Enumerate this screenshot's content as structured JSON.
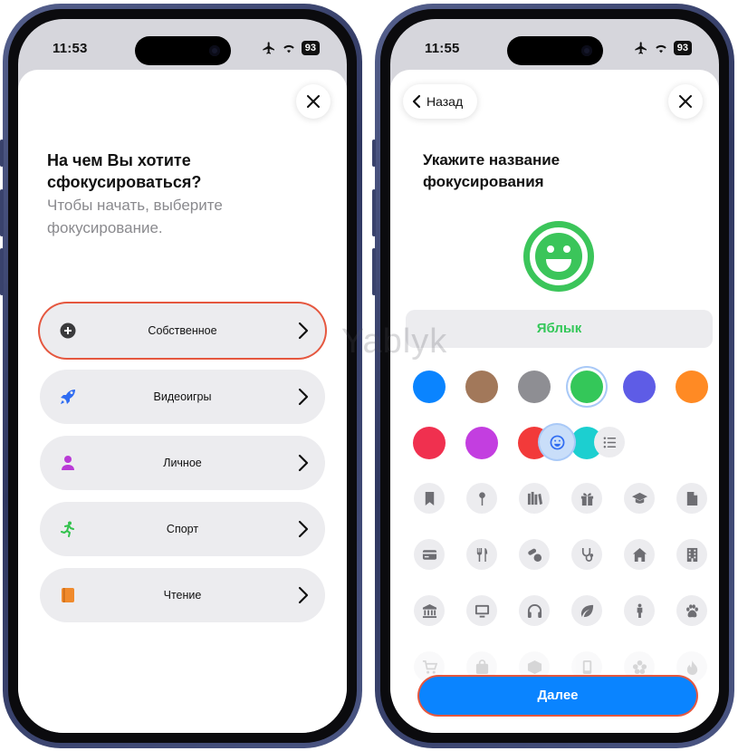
{
  "status_left": {
    "time": "11:53",
    "battery": "93"
  },
  "status_right": {
    "time": "11:55",
    "battery": "93"
  },
  "left": {
    "title": "На чем Вы хотите сфокусироваться?",
    "subtitle": "Чтобы начать, выберите фокусирование.",
    "options": [
      {
        "label": "Собственное",
        "icon": "plus-circle-icon",
        "icon_color": "#3a3a3c",
        "selected": true
      },
      {
        "label": "Видеоигры",
        "icon": "rocket-icon",
        "icon_color": "#2f6cf2",
        "selected": false
      },
      {
        "label": "Личное",
        "icon": "person-icon",
        "icon_color": "#b93bd6",
        "selected": false
      },
      {
        "label": "Спорт",
        "icon": "running-icon",
        "icon_color": "#33c24d",
        "selected": false
      },
      {
        "label": "Чтение",
        "icon": "book-icon",
        "icon_color": "#f08a2c",
        "selected": false
      }
    ]
  },
  "right": {
    "back_label": "Назад",
    "title": "Укажите название фокусирования",
    "focus_name": "Яблык",
    "accent_color": "#3bc55a",
    "colors": [
      "#0a84ff",
      "#a2785a",
      "#8e8e93",
      "#34c759",
      "#5e5ce6",
      "#ff8a24",
      "#f0304f",
      "#c33ee0",
      "#f23a3a",
      "#1ccfd0"
    ],
    "selected_color_index": 3,
    "glyph_rows": [
      [
        "bookmark-icon",
        "pin-icon",
        "books-icon",
        "gift-icon",
        "graduation-cap-icon",
        "document-icon"
      ],
      [
        "credit-card-icon",
        "fork-knife-icon",
        "pills-icon",
        "stethoscope-icon",
        "house-icon",
        "building-icon"
      ],
      [
        "bank-icon",
        "monitor-icon",
        "headphones-icon",
        "leaf-icon",
        "figure-icon",
        "paw-icon"
      ],
      [
        "cart-icon",
        "bag-icon",
        "box-icon",
        "phone-icon",
        "flower-icon",
        "flame-icon"
      ]
    ],
    "next_label": "Далее"
  },
  "watermark": "Yablyk"
}
